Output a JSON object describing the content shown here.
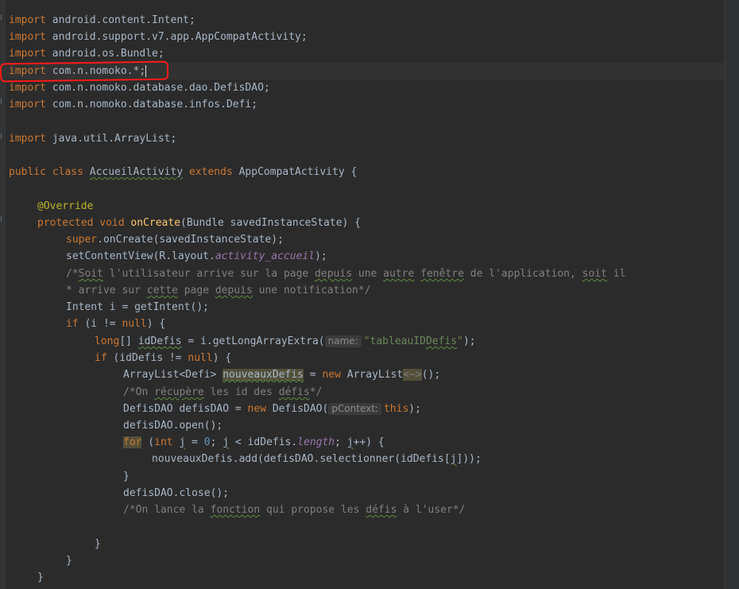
{
  "editor": {
    "language": "Java",
    "colors": {
      "background": "#2b2b2b",
      "keyword": "#cc7832",
      "method": "#ffc66d",
      "string": "#6a8759",
      "number": "#6897bb",
      "comment": "#808080",
      "annotation": "#bbb529",
      "static_field": "#9876aa",
      "text": "#a9b7c6",
      "annotation_box": "#ff1a1a"
    },
    "lines": {
      "l1a": "import",
      "l1b": " android.content.Intent;",
      "l2a": "import",
      "l2b": " android.support.v7.app.AppCompatActivity;",
      "l3a": "import",
      "l3b": " android.os.Bundle;",
      "l4a": "import",
      "l4b": " com.n.nomoko.*;",
      "l5a": "import",
      "l5b": " com.n.nomoko.database.dao.DefisDAO;",
      "l6a": "import",
      "l6b": " com.n.nomoko.database.infos.Defi;",
      "l7a": "import",
      "l7b": " java.util.ArrayList;",
      "l8a": "public class ",
      "l8b": "AccueilActivity",
      "l8c": " extends ",
      "l8d": "AppCompatActivity {",
      "l9": "@Override",
      "l10a": "protected void ",
      "l10b": "onCreate",
      "l10c": "(Bundle savedInstanceState) {",
      "l11a": "super",
      "l11b": ".onCreate(savedInstanceState);",
      "l12a": "setContentView(R.layout.",
      "l12b": "activity_accueil",
      "l12c": ");",
      "l13a": "/*",
      "l13b": "Soit",
      "l13c": " l'utilisateur arrive sur la page ",
      "l13d": "depuis",
      "l13e": " une ",
      "l13f": "autre",
      "l13g": " ",
      "l13h": "fenêtre",
      "l13i": " de l'application, ",
      "l13j": "soit",
      "l13k": " il",
      "l14a": "* arrive sur ",
      "l14b": "cette",
      "l14c": " page ",
      "l14d": "depuis",
      "l14e": " une notification*/",
      "l15": "Intent i = getIntent();",
      "l16a": "if",
      "l16b": " (i != ",
      "l16c": "null",
      "l16d": ") {",
      "l17a": "long",
      "l17b": "[] ",
      "l17c": "idDefis",
      "l17d": " = i.getLongArrayExtra(",
      "l17hint": "name:",
      "l17e": "\"tableauID",
      "l17f": "Defis",
      "l17g": "\"",
      "l17h": ");",
      "l18a": "if",
      "l18b": " (idDefis != ",
      "l18c": "null",
      "l18d": ") {",
      "l19a": "ArrayList<Defi> ",
      "l19b": "nouveauxDefis",
      "l19c": " = ",
      "l19d": "new",
      "l19e": " ArrayList",
      "l19f": "<~>",
      "l19g": "();",
      "l20a": "/*On ",
      "l20b": "récupère",
      "l20c": " les id des ",
      "l20d": "défis",
      "l20e": "*/",
      "l21a": "DefisDAO defisDAO = ",
      "l21b": "new",
      "l21c": " DefisDAO(",
      "l21hint": "pContext:",
      "l21d": "this",
      "l21e": ");",
      "l22": "defisDAO.open();",
      "l23a": "for",
      "l23b": " (",
      "l23c": "int",
      "l23d": " ",
      "l23e": "j",
      "l23f": " = ",
      "l23g": "0",
      "l23h": "; ",
      "l23i": "j",
      "l23j": " < idDefis.",
      "l23k": "length",
      "l23l": "; ",
      "l23m": "j",
      "l23n": "++) {",
      "l24a": "nouveauxDefis.add(defisDAO.selectionner(idDefis[",
      "l24b": "j",
      "l24c": "]));",
      "l25": "}",
      "l26": "defisDAO.close();",
      "l27a": "/*On lance la ",
      "l27b": "fonction",
      "l27c": " qui propose les ",
      "l27d": "défis",
      "l27e": " à l'user*/",
      "l28": "}",
      "l29": "}",
      "l30": "}"
    }
  }
}
